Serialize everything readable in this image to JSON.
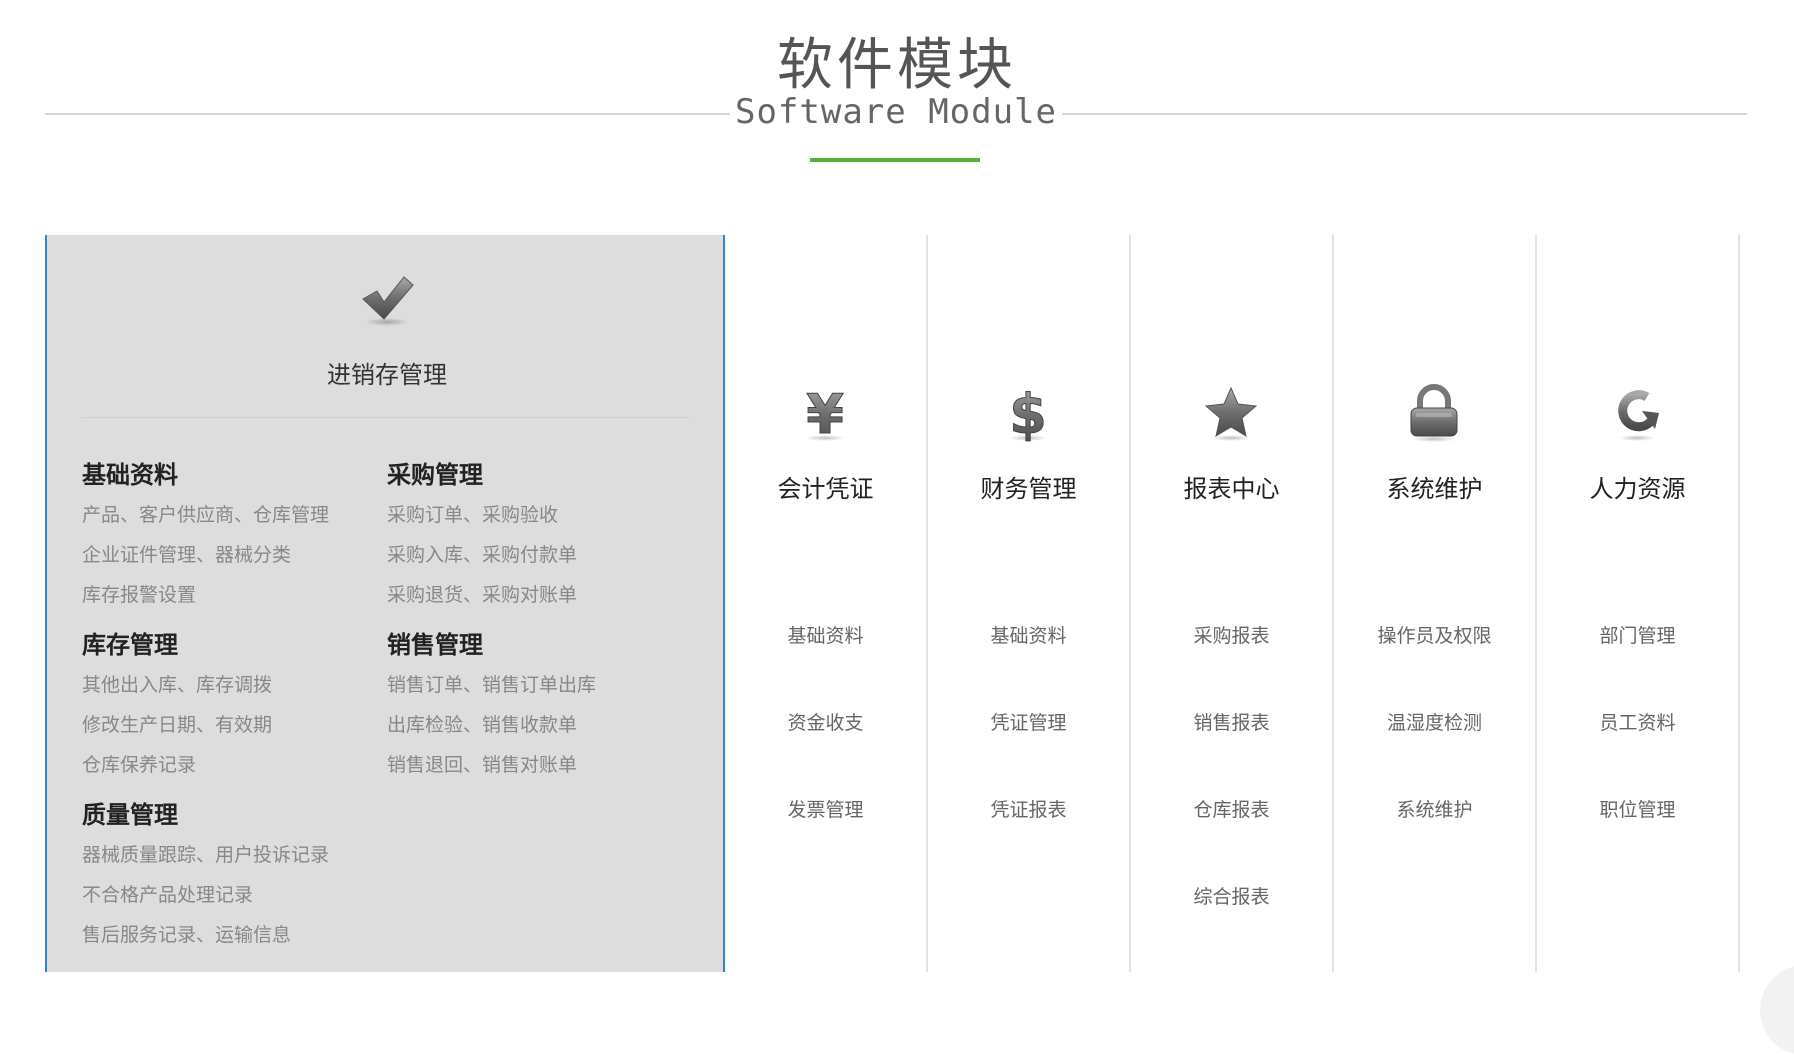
{
  "header": {
    "title": "软件模块",
    "subtitle": "Software Module",
    "accent_color": "#52b434"
  },
  "featured": {
    "icon": "checkmark-icon",
    "title": "进销存管理",
    "border_color": "#2c86d6",
    "groups": [
      {
        "title": "基础资料",
        "items": [
          "产品、客户供应商、仓库管理",
          "企业证件管理、器械分类",
          "库存报警设置"
        ]
      },
      {
        "title": "采购管理",
        "items": [
          "采购订单、采购验收",
          "采购入库、采购付款单",
          "采购退货、采购对账单"
        ]
      },
      {
        "title": "库存管理",
        "items": [
          "其他出入库、库存调拨",
          "修改生产日期、有效期",
          "仓库保养记录"
        ]
      },
      {
        "title": "销售管理",
        "items": [
          "销售订单、销售订单出库",
          "出库检验、销售收款单",
          "销售退回、销售对账单"
        ]
      },
      {
        "title": "质量管理",
        "items": [
          "器械质量跟踪、用户投诉记录",
          "不合格产品处理记录",
          "售后服务记录、运输信息"
        ]
      }
    ]
  },
  "modules": [
    {
      "icon": "yen-icon",
      "title": "会计凭证",
      "items": [
        "基础资料",
        "资金收支",
        "发票管理"
      ]
    },
    {
      "icon": "dollar-icon",
      "title": "财务管理",
      "items": [
        "基础资料",
        "凭证管理",
        "凭证报表"
      ]
    },
    {
      "icon": "star-icon",
      "title": "报表中心",
      "items": [
        "采购报表",
        "销售报表",
        "仓库报表",
        "综合报表"
      ]
    },
    {
      "icon": "lock-icon",
      "title": "系统维护",
      "items": [
        "操作员及权限",
        "温湿度检测",
        "系统维护"
      ]
    },
    {
      "icon": "refresh-icon",
      "title": "人力资源",
      "items": [
        "部门管理",
        "员工资料",
        "职位管理"
      ]
    }
  ]
}
